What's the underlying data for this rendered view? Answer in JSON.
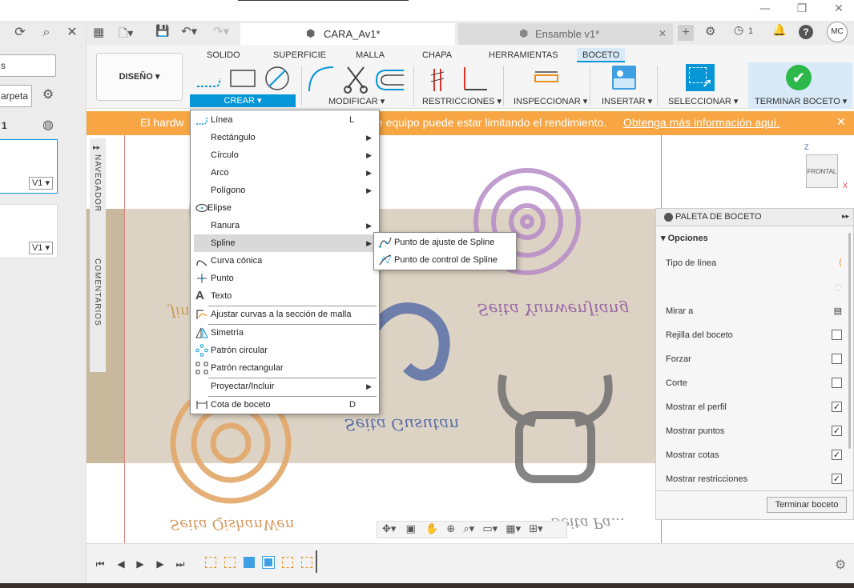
{
  "window": {
    "min": "—",
    "max": "❐",
    "close": "✕"
  },
  "left_panel": {
    "field1_text": "s",
    "folder_btn": "arpeta",
    "section_num": "1",
    "version_tag_1": "V1 ▾",
    "version_tag_2": "V1 ▾"
  },
  "tabs": [
    {
      "label": "CARA_Av1*",
      "close": "✕"
    },
    {
      "label": "Ensamble v1*",
      "close": "✕"
    }
  ],
  "toolbar": {
    "add_tab": "+",
    "notif_count": "1",
    "user": "MC"
  },
  "ribbon": {
    "workspace": "DISEÑO ▾",
    "tabs": [
      "SOLIDO",
      "SUPERFICIE",
      "MALLA",
      "CHAPA",
      "HERRAMIENTAS",
      "BOCETO"
    ],
    "active_tab": "BOCETO",
    "groups": {
      "crear": "CREAR ▾",
      "modificar": "MODIFICAR ▾",
      "restricciones": "RESTRICCIONES ▾",
      "inspeccionar": "INSPECCIONAR ▾",
      "insertar": "INSERTAR ▾",
      "seleccionar": "SELECCIONAR ▾",
      "terminar": "TERMINAR BOCETO ▾"
    }
  },
  "banner": {
    "text_left": "El hardw",
    "text_right": "e equipo puede estar limitando el rendimiento.",
    "link": "Obtenga más información aquí.",
    "close": "✕"
  },
  "crear_menu": [
    {
      "label": "Línea",
      "shortcut": "L"
    },
    {
      "label": "Rectángulo",
      "arrow": "▶"
    },
    {
      "label": "Círculo",
      "arrow": "▶"
    },
    {
      "label": "Arco",
      "arrow": "▶"
    },
    {
      "label": "Polígono",
      "arrow": "▶"
    },
    {
      "label": "Elipse"
    },
    {
      "label": "Ranura",
      "arrow": "▶"
    },
    {
      "label": "Spline",
      "arrow": "▶"
    },
    {
      "label": "Curva cónica"
    },
    {
      "label": "Punto"
    },
    {
      "label": "Texto"
    },
    {
      "label": "Ajustar curvas a la sección de malla"
    },
    {
      "label": "Simetría"
    },
    {
      "label": "Patrón circular"
    },
    {
      "label": "Patrón rectangular"
    },
    {
      "label": "Proyectar/Incluir",
      "arrow": "▶"
    },
    {
      "label": "Cota de boceto",
      "shortcut": "D"
    }
  ],
  "spline_submenu": [
    "Punto de ajuste de Spline",
    "Punto de control de Spline"
  ],
  "side_tabs": {
    "navegador": "NAVEGADOR",
    "comentarios": "COMENTARIOS",
    "expand": "▸▸"
  },
  "canvas_text": {
    "t1": "Seita YunwenJiang",
    "t2": "Seita Gusutan",
    "t3": "Seita QishanWen",
    "t4": "Seita Pa...",
    "t5": "Jin"
  },
  "viewcube": {
    "face": "FRONTAL",
    "z": "Z",
    "x": "X"
  },
  "palette": {
    "title": "PALETA DE BOCETO",
    "expand": "▸▸",
    "section": "Opciones",
    "rows": [
      {
        "label": "Tipo de línea"
      },
      {
        "label": ""
      },
      {
        "label": "Mirar a"
      },
      {
        "label": "Rejilla del boceto",
        "checked": false
      },
      {
        "label": "Forzar",
        "checked": false
      },
      {
        "label": "Corte",
        "checked": false
      },
      {
        "label": "Mostrar el perfil",
        "checked": true
      },
      {
        "label": "Mostrar puntos",
        "checked": true
      },
      {
        "label": "Mostrar cotas",
        "checked": true
      },
      {
        "label": "Mostrar restricciones",
        "checked": true
      }
    ],
    "check_mark": "✓",
    "finish_btn": "Terminar boceto"
  },
  "timeline": {
    "first": "⏮",
    "prev": "◀",
    "play": "▶",
    "next": "▶",
    "last": "⏭",
    "gear": "⚙"
  },
  "colors": {
    "accent_blue": "#0696d7",
    "banner_orange": "#f7a643",
    "finish_green": "#2db84b"
  }
}
